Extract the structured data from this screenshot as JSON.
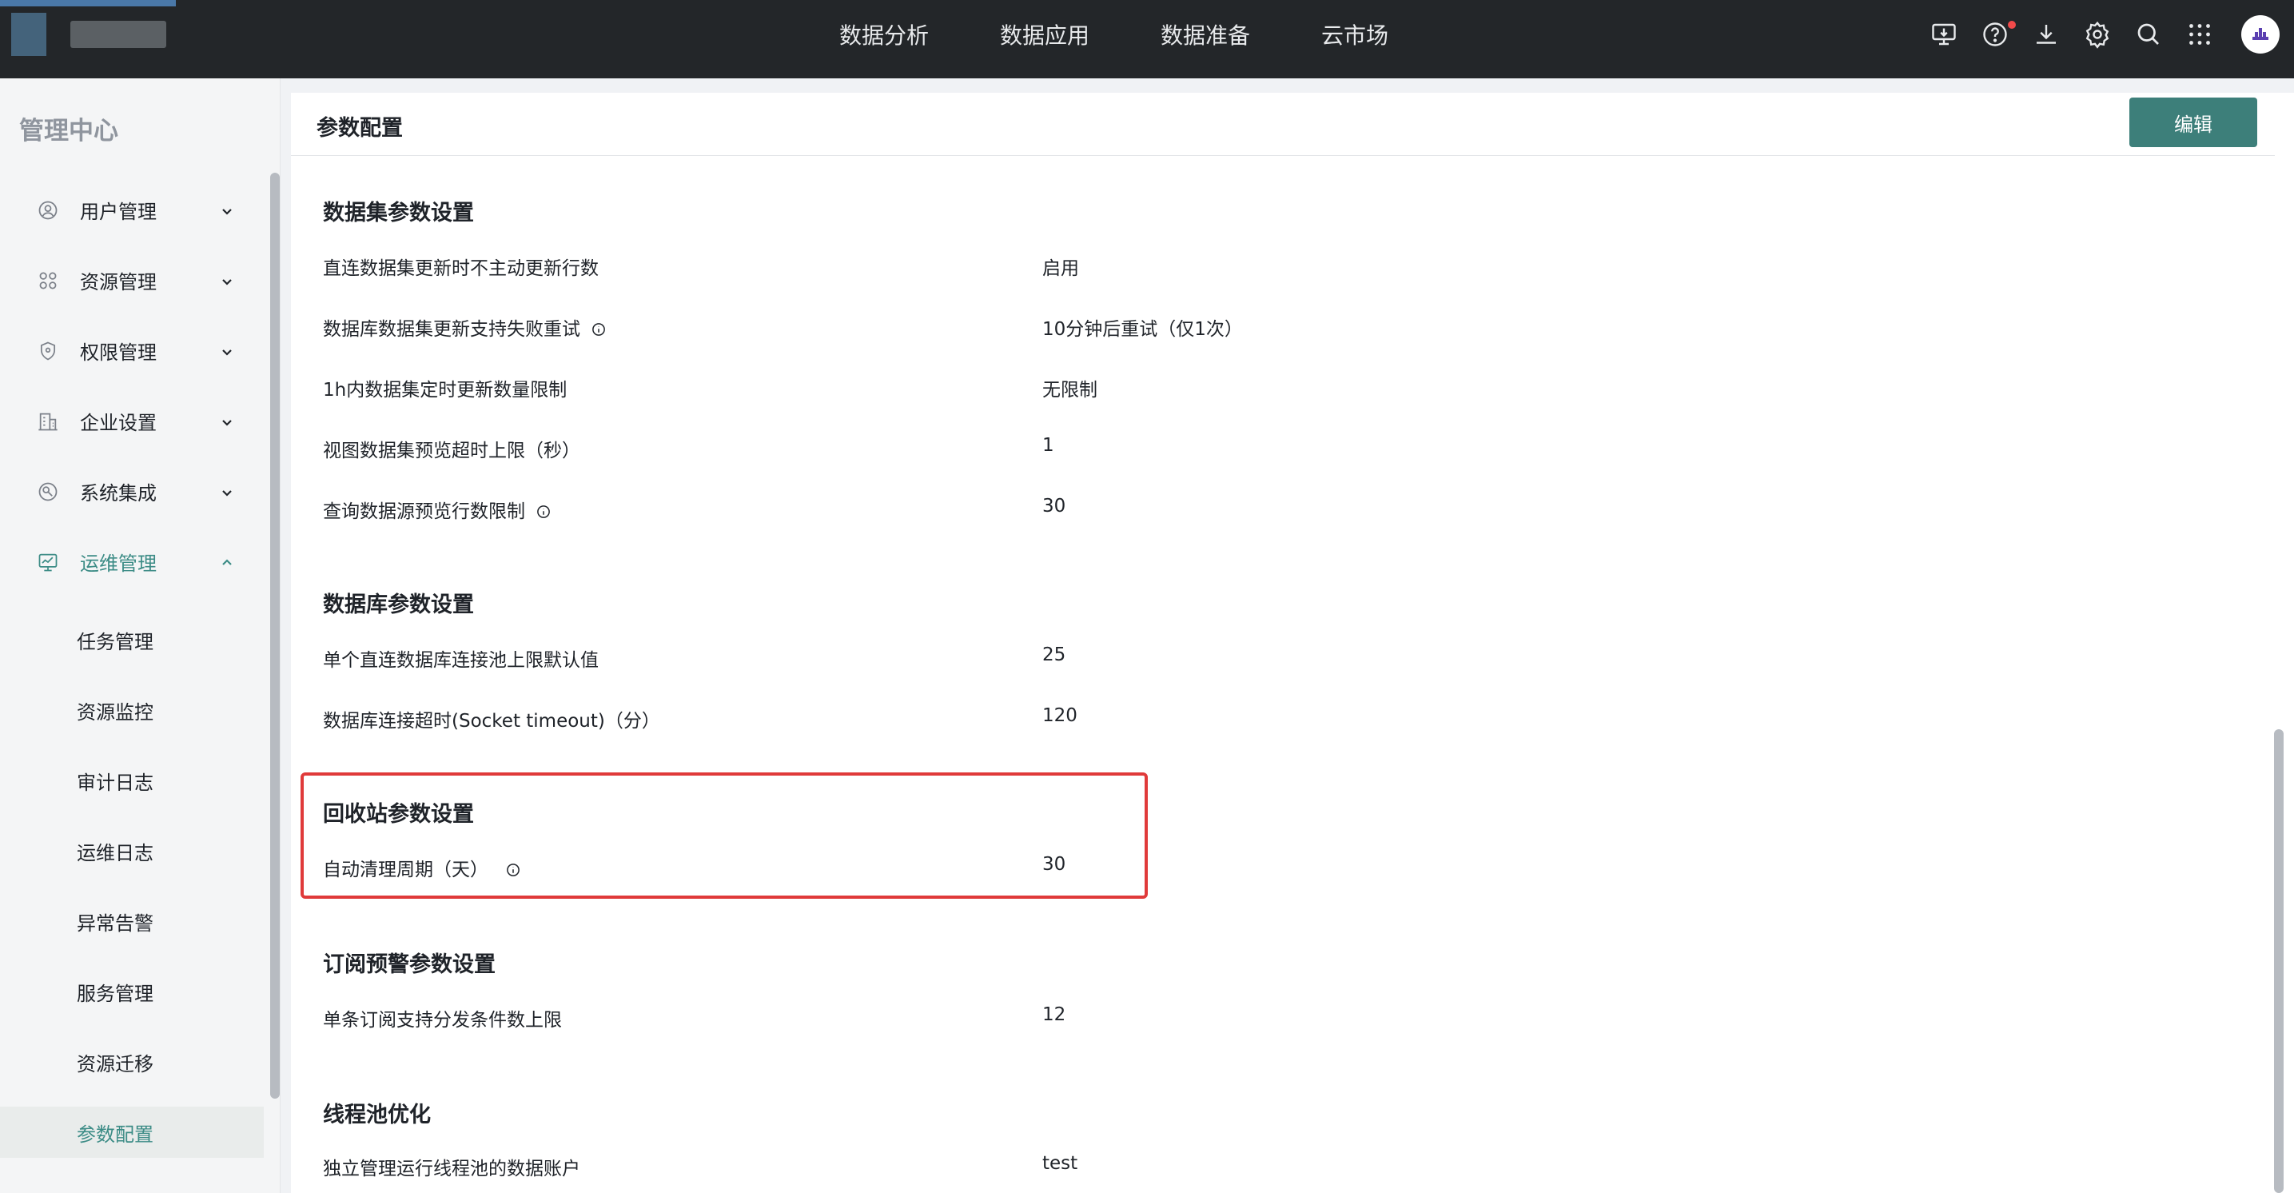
{
  "nav": {
    "items": [
      "数据分析",
      "数据应用",
      "数据准备",
      "云市场"
    ]
  },
  "top_icons": [
    "monitor-download-icon",
    "help-icon",
    "download-icon",
    "gear-icon",
    "search-icon",
    "apps-grid-icon"
  ],
  "sidebar": {
    "title": "管理中心",
    "menu": [
      {
        "label": "用户管理",
        "icon": "user-icon",
        "expanded": false
      },
      {
        "label": "资源管理",
        "icon": "grid-icon",
        "expanded": false
      },
      {
        "label": "权限管理",
        "icon": "shield-icon",
        "expanded": false
      },
      {
        "label": "企业设置",
        "icon": "building-icon",
        "expanded": false
      },
      {
        "label": "系统集成",
        "icon": "integration-icon",
        "expanded": false
      },
      {
        "label": "运维管理",
        "icon": "monitor-icon",
        "expanded": true
      }
    ],
    "sub_items": [
      "任务管理",
      "资源监控",
      "审计日志",
      "运维日志",
      "异常告警",
      "服务管理",
      "资源迁移",
      "参数配置"
    ],
    "current_sub": "参数配置"
  },
  "main": {
    "title": "参数配置",
    "edit_label": "编辑",
    "sections": [
      {
        "title": "数据集参数设置",
        "rows": [
          {
            "label": "直连数据集更新时不主动更新行数",
            "value": "启用"
          },
          {
            "label": "数据库数据集更新支持失败重试",
            "value": "10分钟后重试（仅1次）"
          },
          {
            "label": "1h内数据集定时更新数量限制",
            "value": "无限制"
          },
          {
            "label": "视图数据集预览超时上限（秒）",
            "value": "1"
          },
          {
            "label": "查询数据源预览行数限制",
            "value": "30"
          }
        ]
      },
      {
        "title": "数据库参数设置",
        "rows": [
          {
            "label": "单个直连数据库连接池上限默认值",
            "value": "25"
          },
          {
            "label": "数据库连接超时(Socket timeout)（分）",
            "value": "120"
          }
        ]
      },
      {
        "title": "回收站参数设置",
        "rows": [
          {
            "label": "自动清理周期（天）",
            "value": "30"
          }
        ]
      },
      {
        "title": "订阅预警参数设置",
        "rows": [
          {
            "label": "单条订阅支持分发条件数上限",
            "value": "12"
          }
        ]
      },
      {
        "title": "线程池优化",
        "rows": [
          {
            "label": "独立管理运行线程池的数据账户",
            "value": "test"
          }
        ]
      }
    ]
  },
  "colors": {
    "topbar": "#232629",
    "accent": "#3c8c86",
    "button": "#3d7f7a",
    "highlight": "#e03a3a"
  }
}
